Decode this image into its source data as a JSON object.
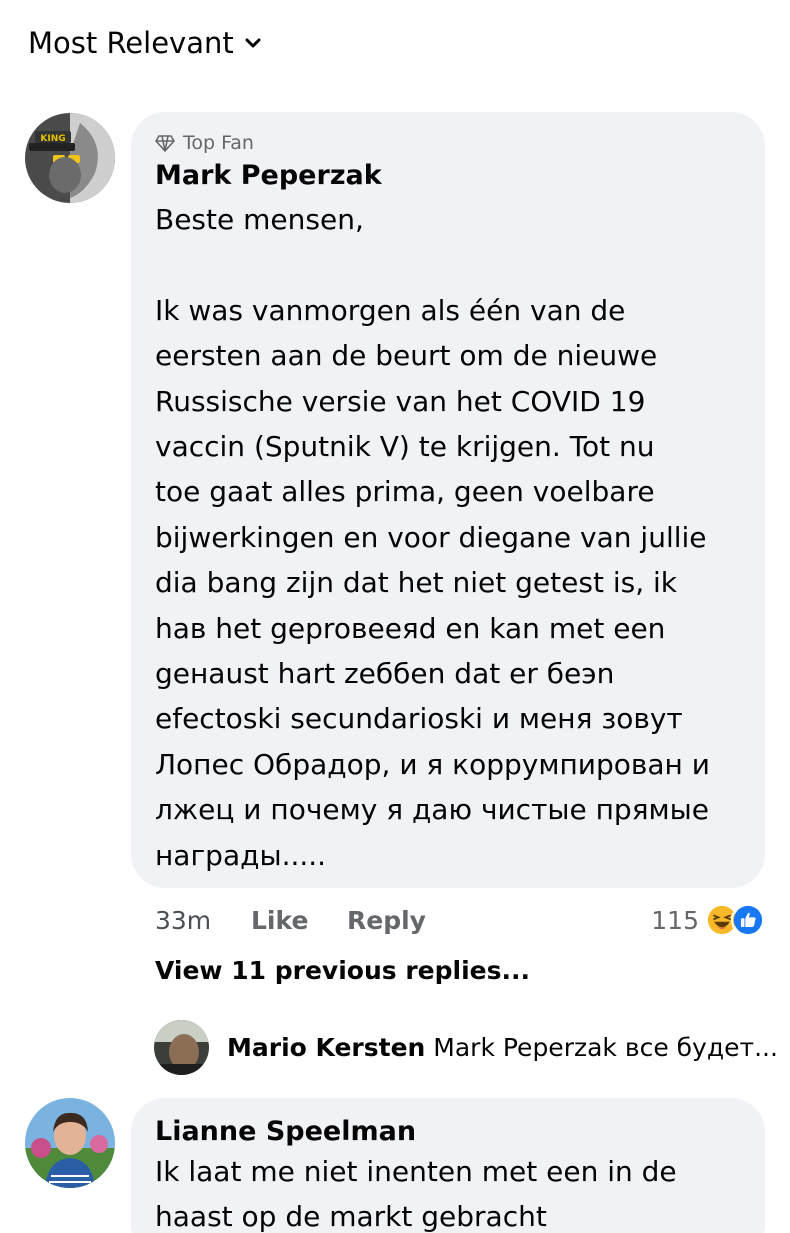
{
  "sort": {
    "label": "Most Relevant"
  },
  "comment1": {
    "badge": "Top Fan",
    "author": "Mark Peperzak",
    "text": "Beste mensen,\n\nIk was vanmorgen als één van de\neersten aan de beurt om de nieuwe\nRussische versie van het COVID 19\nvaccin (Sputnik V) te krijgen. Tot nu\ntoe gaat alles prima, geen voelbare\nbijwerkingen en voor diegane van jullie\ndia bang zijn dat het niet getest is, ik\nhaв het geproвeeяd en kan met een\ngeнaust hart zeббen dat er бeэn\nefectoski secundarioski и меня зовут\nЛопес Обрадор, и я коррумпирован и\nлжец и почему я даю чистые прямые\nнаграды.....",
    "time": "33m",
    "like": "Like",
    "reply": "Reply",
    "reaction_count": "115",
    "view_replies": "View 11 previous replies..."
  },
  "reply1": {
    "author": "Mario Kersten",
    "text": "Mark Peperzak все будет..."
  },
  "comment2": {
    "author": "Lianne Speelman",
    "text": "Ik laat me niet inenten met een in de\nhaast op de markt gebracht"
  },
  "colors": {
    "bubble": "#f0f2f5",
    "secondary_text": "#65676b",
    "like_blue": "#1877f2",
    "haha_yellow": "#f7b928"
  }
}
